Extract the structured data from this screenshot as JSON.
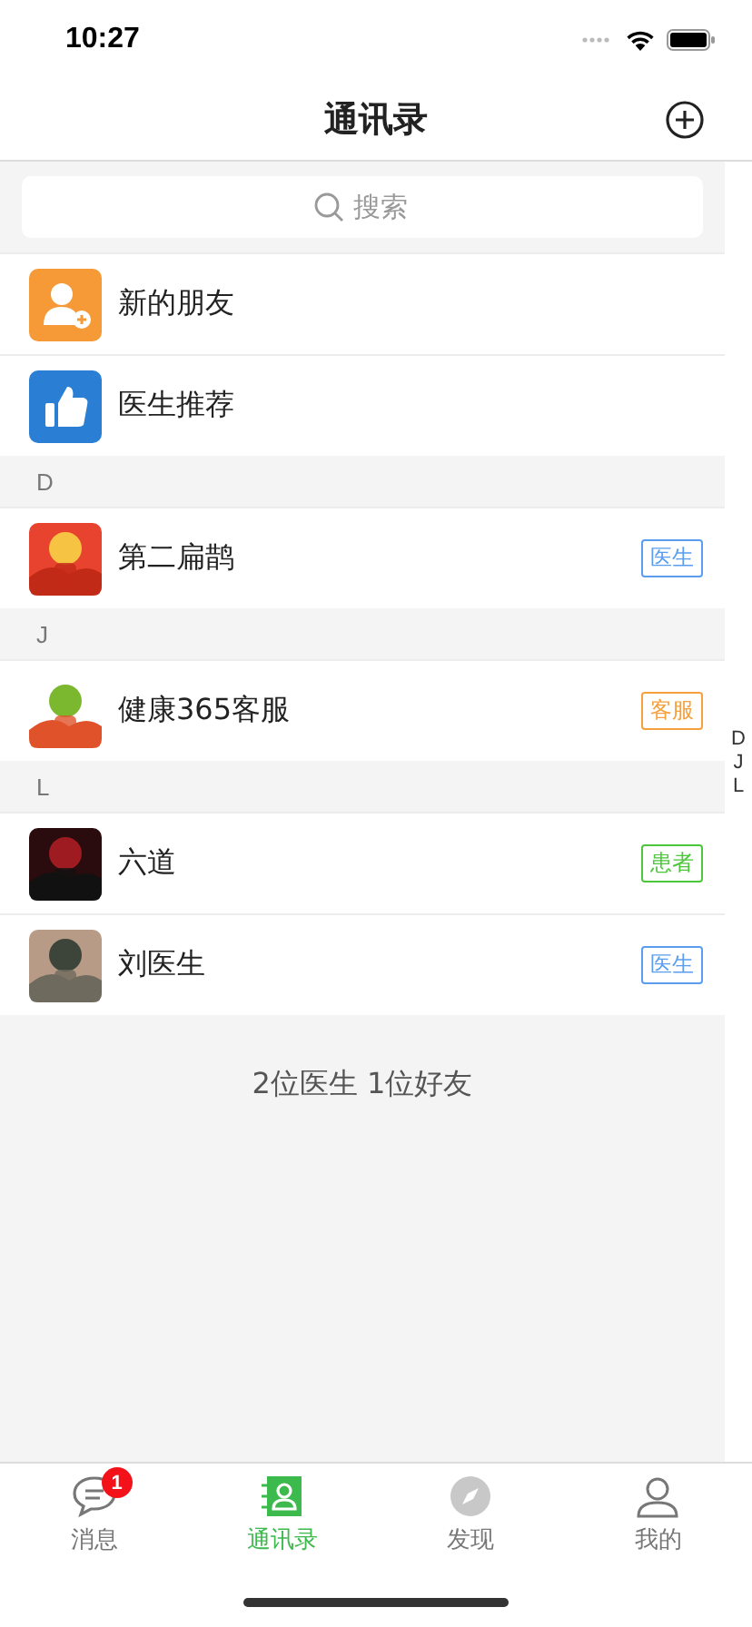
{
  "status_bar": {
    "time": "10:27"
  },
  "nav": {
    "title": "通讯录"
  },
  "search": {
    "placeholder": "搜索"
  },
  "shortcuts": [
    {
      "label": "新的朋友",
      "kind": "new-friend"
    },
    {
      "label": "医生推荐",
      "kind": "recommend"
    }
  ],
  "sections": [
    {
      "letter": "D",
      "contacts": [
        {
          "name": "第二扁鹊",
          "tag": "医生",
          "color": "#5b9ef0"
        }
      ]
    },
    {
      "letter": "J",
      "contacts": [
        {
          "name": "健康365客服",
          "tag": "客服",
          "color": "#f5a03c"
        }
      ]
    },
    {
      "letter": "L",
      "contacts": [
        {
          "name": "六道",
          "tag": "患者",
          "color": "#4cc63a"
        },
        {
          "name": "刘医生",
          "tag": "医生",
          "color": "#5b9ef0"
        }
      ]
    }
  ],
  "index": [
    "D",
    "J",
    "L"
  ],
  "footer": "2位医生 1位好友",
  "tabs": [
    {
      "label": "消息",
      "kind": "chat",
      "selected": false,
      "badge": "1"
    },
    {
      "label": "通讯录",
      "kind": "contacts",
      "selected": true
    },
    {
      "label": "发现",
      "kind": "compass",
      "selected": false
    },
    {
      "label": "我的",
      "kind": "person",
      "selected": false
    }
  ]
}
